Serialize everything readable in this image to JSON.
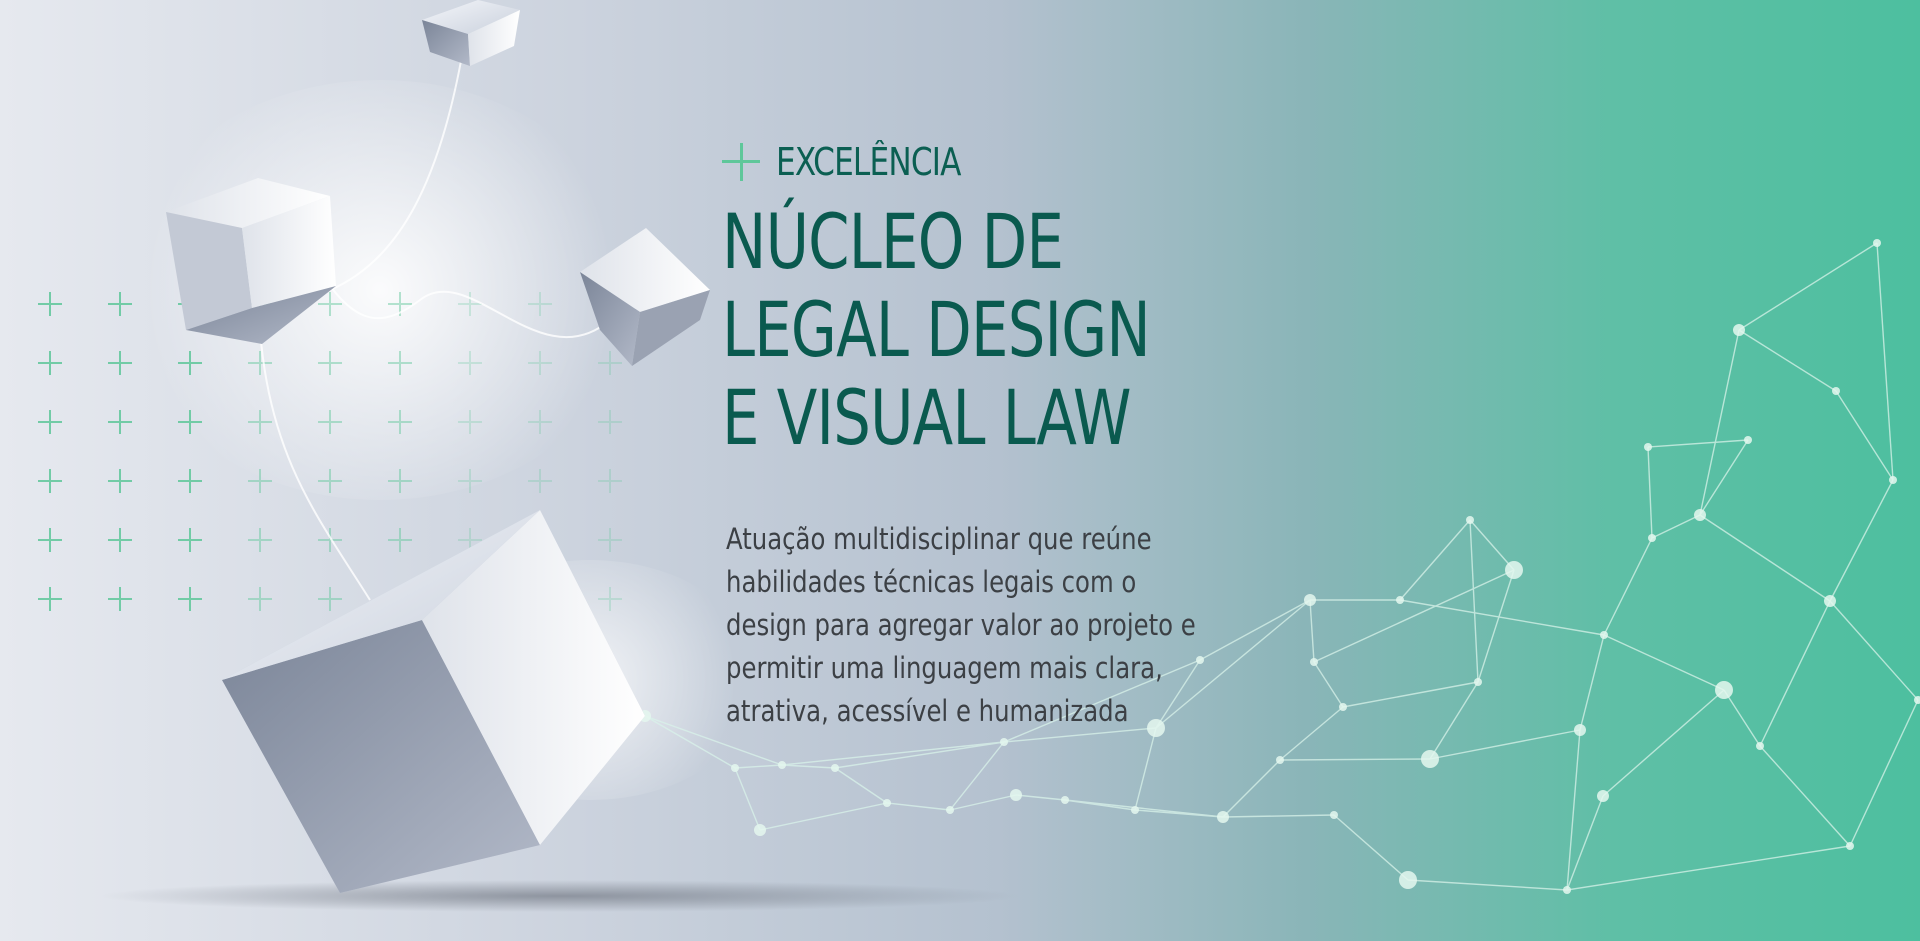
{
  "hero": {
    "eyebrow": {
      "icon": "plus-icon",
      "label": "EXCELÊNCIA"
    },
    "title_lines": [
      "NÚCLEO DE",
      "LEGAL DESIGN",
      "E VISUAL LAW"
    ],
    "description_lines": [
      "Atuação multidisciplinar que reúne",
      "habilidades técnicas legais com o",
      "design para agregar valor ao projeto e",
      "permitir uma linguagem mais clara,",
      "atrativa, acessível e humanizada"
    ]
  },
  "colors": {
    "accent": "#5fc79a",
    "title": "#0a5a4f",
    "text": "#3c4045",
    "gradient_end": "#4dbf9f"
  }
}
